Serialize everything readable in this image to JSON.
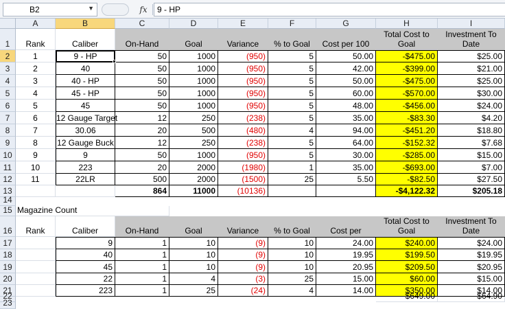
{
  "formula_bar": {
    "name_box": "B2",
    "fx_label": "fx",
    "formula": "9 - HP"
  },
  "columns": [
    "A",
    "B",
    "C",
    "D",
    "E",
    "F",
    "G",
    "H",
    "I"
  ],
  "row_numbers": [
    "1",
    "2",
    "3",
    "4",
    "5",
    "6",
    "7",
    "8",
    "9",
    "10",
    "11",
    "12",
    "13",
    "14",
    "15",
    "16",
    "17",
    "18",
    "19",
    "20",
    "21",
    "22",
    "23"
  ],
  "ammo_table": {
    "headers": [
      "Rank",
      "Caliber",
      "On-Hand",
      "Goal",
      "Variance",
      "% to Goal",
      "Cost per 100",
      "Total Cost to Goal",
      "Investment To Date"
    ],
    "header_lines": {
      "total_cost": [
        "Total Cost to",
        "Goal"
      ],
      "investment": [
        "Investment To",
        "Date"
      ]
    },
    "rows": [
      [
        "1",
        "9 - HP",
        "50",
        "1000",
        "(950)",
        "5",
        "50.00",
        "-$475.00",
        "$25.00"
      ],
      [
        "2",
        "40",
        "50",
        "1000",
        "(950)",
        "5",
        "42.00",
        "-$399.00",
        "$21.00"
      ],
      [
        "3",
        "40 - HP",
        "50",
        "1000",
        "(950)",
        "5",
        "50.00",
        "-$475.00",
        "$25.00"
      ],
      [
        "4",
        "45 - HP",
        "50",
        "1000",
        "(950)",
        "5",
        "60.00",
        "-$570.00",
        "$30.00"
      ],
      [
        "5",
        "45",
        "50",
        "1000",
        "(950)",
        "5",
        "48.00",
        "-$456.00",
        "$24.00"
      ],
      [
        "6",
        "12 Gauge Target",
        "12",
        "250",
        "(238)",
        "5",
        "35.00",
        "-$83.30",
        "$4.20"
      ],
      [
        "7",
        "30.06",
        "20",
        "500",
        "(480)",
        "4",
        "94.00",
        "-$451.20",
        "$18.80"
      ],
      [
        "8",
        "12 Gauge Buck",
        "12",
        "250",
        "(238)",
        "5",
        "64.00",
        "-$152.32",
        "$7.68"
      ],
      [
        "9",
        "9",
        "50",
        "1000",
        "(950)",
        "5",
        "30.00",
        "-$285.00",
        "$15.00"
      ],
      [
        "10",
        "223",
        "20",
        "2000",
        "(1980)",
        "1",
        "35.00",
        "-$693.00",
        "$7.00"
      ],
      [
        "11",
        "22LR",
        "500",
        "2000",
        "(1500)",
        "25",
        "5.50",
        "-$82.50",
        "$27.50"
      ]
    ],
    "totals": {
      "on_hand": "864",
      "goal": "11000",
      "variance": "(10136)",
      "total_cost": "-$4,122.32",
      "investment": "$205.18"
    }
  },
  "magazine_section": {
    "title": "Magazine Count",
    "headers": [
      "Rank",
      "Caliber",
      "On-Hand",
      "Goal",
      "Variance",
      "% to Goal",
      "Cost per",
      "Total Cost to Goal",
      "Investment To Date"
    ],
    "rows": [
      [
        "9",
        "1",
        "10",
        "(9)",
        "10",
        "24.00",
        "$240.00",
        "$24.00"
      ],
      [
        "40",
        "1",
        "10",
        "(9)",
        "10",
        "19.95",
        "$199.50",
        "$19.95"
      ],
      [
        "45",
        "1",
        "10",
        "(9)",
        "10",
        "20.95",
        "$209.50",
        "$20.95"
      ],
      [
        "22",
        "1",
        "4",
        "(3)",
        "25",
        "15.00",
        "$60.00",
        "$15.00"
      ],
      [
        "223",
        "1",
        "25",
        "(24)",
        "4",
        "14.00",
        "$350.00",
        "$14.00"
      ]
    ],
    "totals": {
      "total_cost": "$649.00",
      "investment": "$64.90"
    }
  },
  "colors": {
    "highlight": "#ffff00",
    "negative": "#e00000",
    "header_fill": "#c7c7c7",
    "selection": "#f8d77c"
  }
}
